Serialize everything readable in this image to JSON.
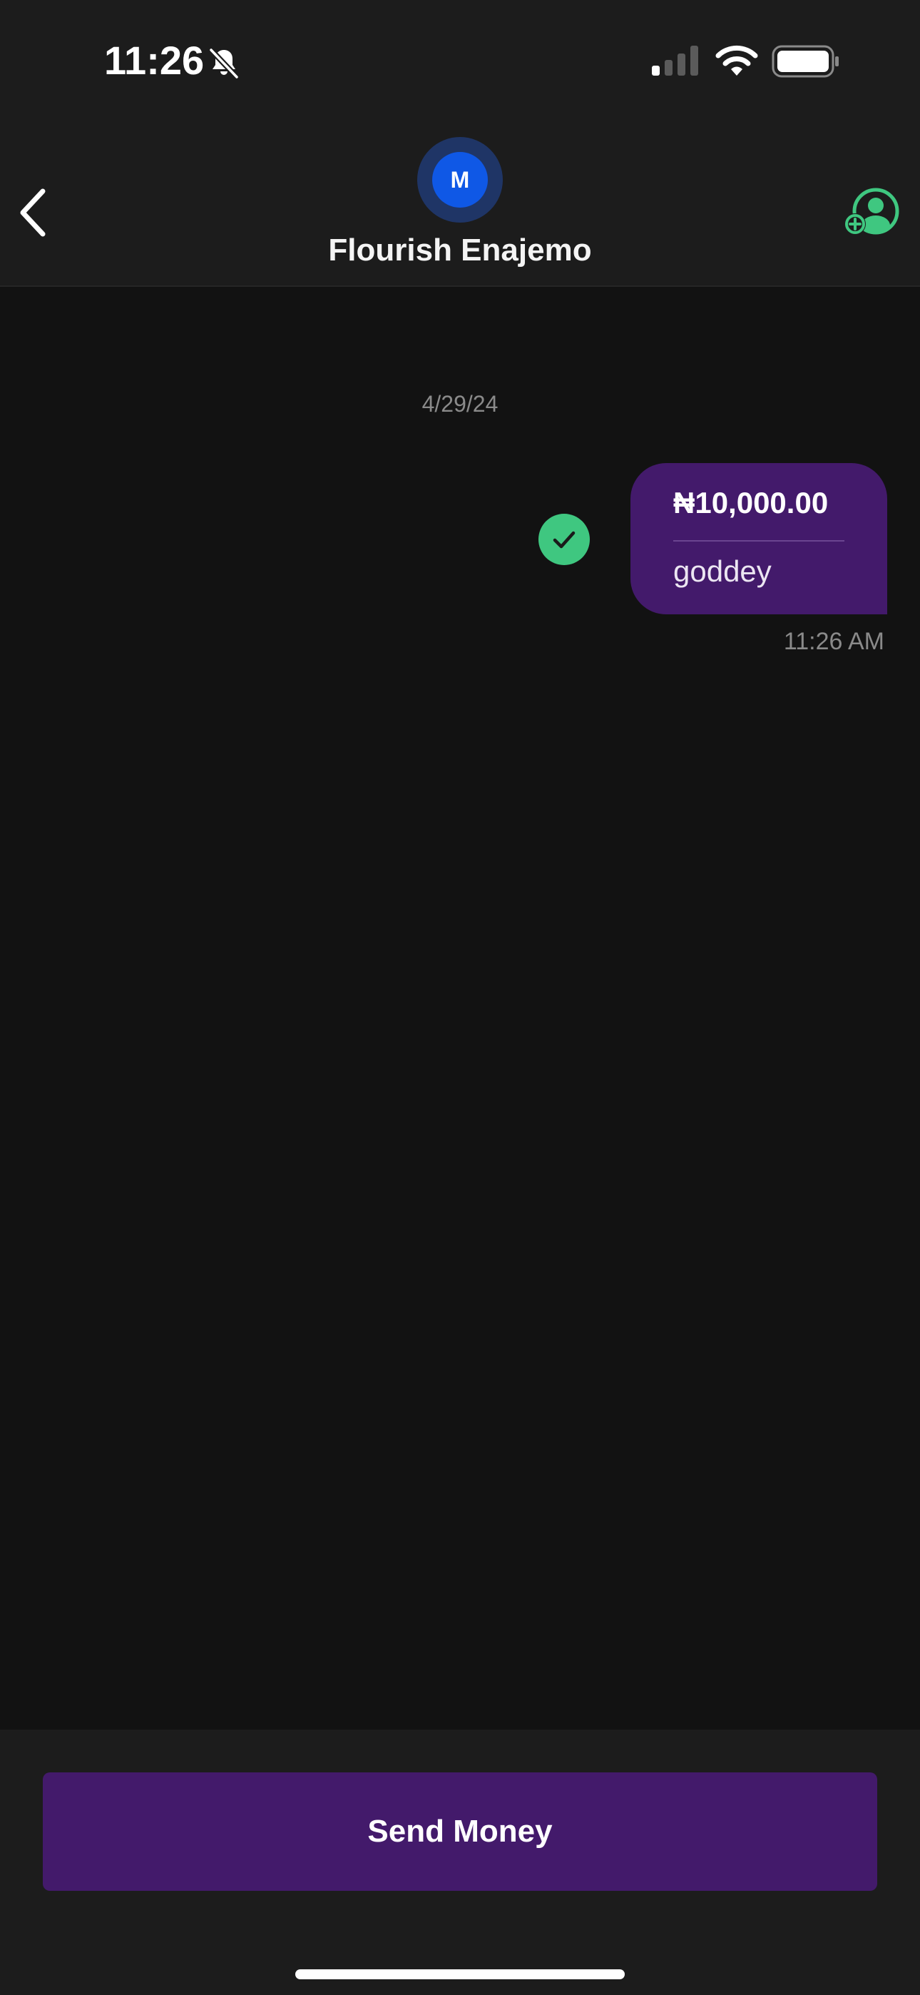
{
  "status_bar": {
    "time": "11:26",
    "icons": [
      "bell-off-icon",
      "cellular-signal-icon",
      "wifi-icon",
      "battery-icon"
    ]
  },
  "header": {
    "avatar_initial": "M",
    "contact_name": "Flourish Enajemo",
    "icons": [
      "chevron-left-icon",
      "add-contact-icon"
    ]
  },
  "chat": {
    "date": "4/29/24",
    "messages": [
      {
        "amount": "₦10,000.00",
        "note": "goddey",
        "time": "11:26 AM",
        "status": "delivered"
      }
    ]
  },
  "footer": {
    "send_label": "Send Money"
  },
  "colors": {
    "background": "#121212",
    "bar": "#1c1c1c",
    "accent_purple": "#431a6b",
    "success_green": "#3fc780",
    "avatar_blue": "#0f58e6"
  }
}
